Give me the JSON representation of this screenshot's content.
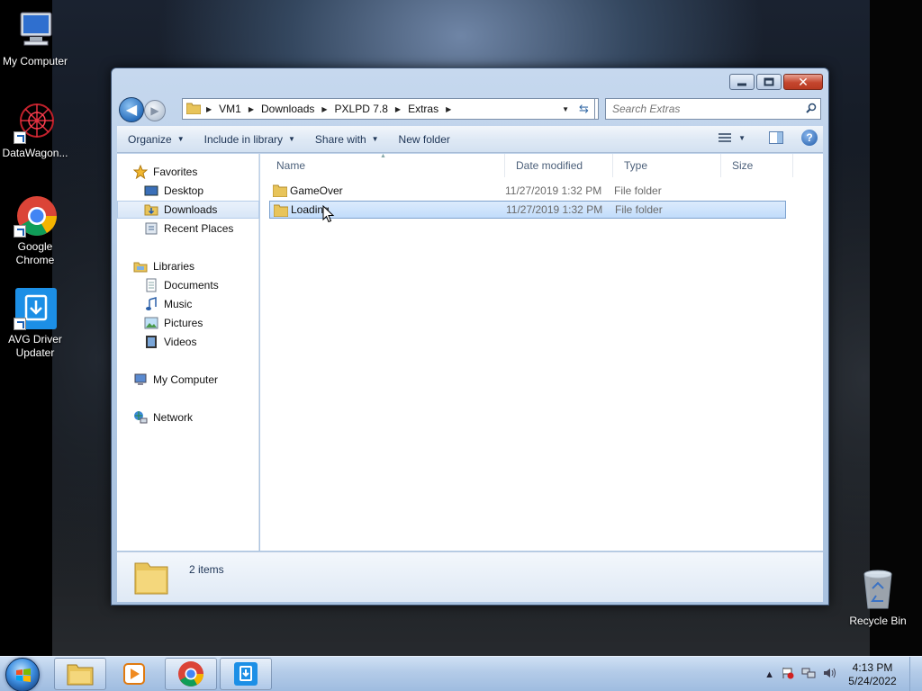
{
  "desktop": {
    "icons": [
      {
        "label": "My Computer",
        "icon": "computer-icon"
      },
      {
        "label": "DataWagon...",
        "icon": "datawagon-icon"
      },
      {
        "label": "Google Chrome",
        "icon": "chrome-icon"
      },
      {
        "label": "AVG Driver Updater",
        "icon": "avg-driver-updater-icon"
      },
      {
        "label": "Recycle Bin",
        "icon": "recycle-bin-icon"
      }
    ]
  },
  "window": {
    "breadcrumb": [
      "VM1",
      "Downloads",
      "PXLPD 7.8",
      "Extras"
    ],
    "search_placeholder": "Search Extras",
    "commands": {
      "organize": "Organize",
      "include_in_library": "Include in library",
      "share_with": "Share with",
      "new_folder": "New folder"
    },
    "nav": {
      "favorites": "Favorites",
      "desktop": "Desktop",
      "downloads": "Downloads",
      "recent_places": "Recent Places",
      "libraries": "Libraries",
      "documents": "Documents",
      "music": "Music",
      "pictures": "Pictures",
      "videos": "Videos",
      "my_computer": "My Computer",
      "network": "Network"
    },
    "columns": {
      "name": "Name",
      "date_modified": "Date modified",
      "type": "Type",
      "size": "Size"
    },
    "files": [
      {
        "name": "GameOver",
        "date": "11/27/2019 1:32 PM",
        "type": "File folder",
        "selected": false
      },
      {
        "name": "Loading",
        "date": "11/27/2019 1:32 PM",
        "type": "File folder",
        "selected": true
      }
    ],
    "status": {
      "items": "2 items"
    }
  },
  "taskbar": {
    "time": "4:13 PM",
    "date": "5/24/2022"
  },
  "colors": {
    "selection": "#c1dcfb",
    "close_button": "#c4462e",
    "taskbar": "#b3cbe8"
  }
}
